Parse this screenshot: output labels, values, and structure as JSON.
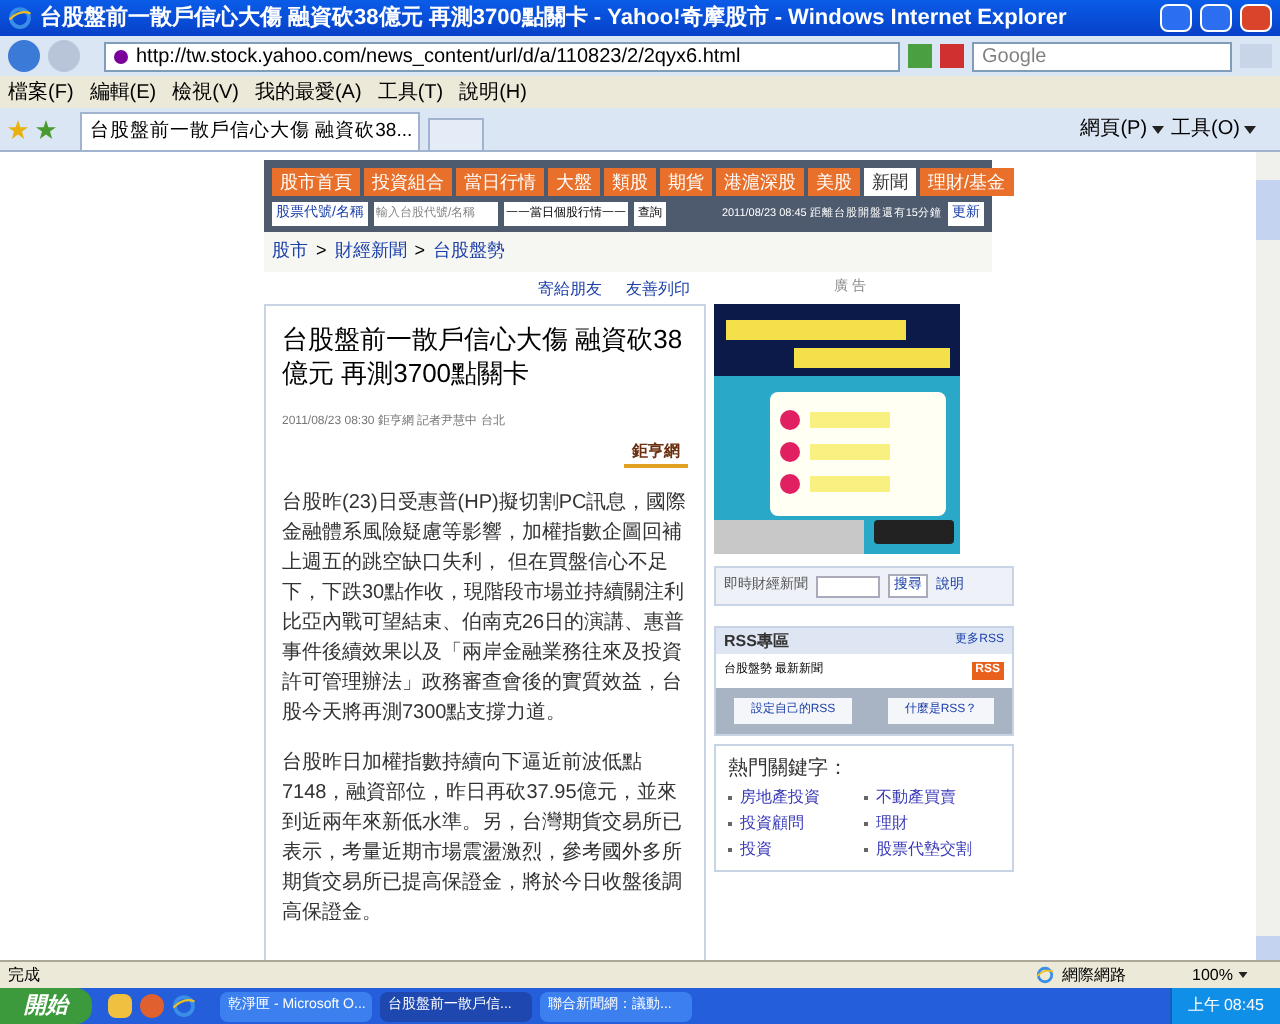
{
  "window": {
    "title": "台股盤前一散戶信心大傷 融資砍38億元 再測3700點關卡 - Yahoo!奇摩股市 - Windows Internet Explorer"
  },
  "address": {
    "url": "http://tw.stock.yahoo.com/news_content/url/d/a/110823/2/2qyx6.html"
  },
  "search": {
    "placeholder": "Google"
  },
  "menu": [
    "檔案(F)",
    "編輯(E)",
    "檢視(V)",
    "我的最愛(A)",
    "工具(T)",
    "說明(H)"
  ],
  "tab": {
    "title": "台股盤前一散戶信心大傷 融資砍38..."
  },
  "command_bar": [
    "網頁(P)",
    "工具(O)"
  ],
  "nav_tabs": [
    {
      "label": "股市首頁",
      "selected": false
    },
    {
      "label": "投資組合",
      "selected": false
    },
    {
      "label": "當日行情",
      "selected": false
    },
    {
      "label": "大盤",
      "selected": false
    },
    {
      "label": "類股",
      "selected": false
    },
    {
      "label": "期貨",
      "selected": false
    },
    {
      "label": "港滬深股",
      "selected": false
    },
    {
      "label": "美股",
      "selected": false
    },
    {
      "label": "新聞",
      "selected": true
    },
    {
      "label": "理財/基金",
      "selected": false
    }
  ],
  "quote_bar": {
    "label": "股票代號/名稱",
    "placeholder": "輸入台股代號/名稱",
    "select": "一一當日個股行情一一",
    "button": "查詢",
    "notice": "2011/08/23 08:45 距離台股開盤還有15分鐘",
    "refresh": "更新"
  },
  "breadcrumb": [
    "股市",
    "財經新聞",
    "台股盤勢"
  ],
  "breadcrumb_separator": ">",
  "tools": [
    "寄給朋友",
    "友善列印"
  ],
  "ad_label": "廣 告",
  "article": {
    "title": "台股盤前一散戶信心大傷 融資砍38億元 再測3700點關卡",
    "byline": "2011/08/23 08:30 鉅亨網 記者尹慧中 台北",
    "source": "鉅亨網",
    "paragraphs": [
      "台股昨(23)日受惠普(HP)擬切割PC訊息，國際金融體系風險疑慮等影響，加權指數企圖回補上週五的跳空缺口失利， 但在買盤信心不足下，下跌30點作收，現階段市場並持續關注利比亞內戰可望結束、伯南克26日的演講、惠普事件後續效果以及「兩岸金融業務往來及投資許可管理辦法」政務審查會後的實質效益，台股今天將再測7300點支撐力道。",
      "台股昨日加權指數持續向下逼近前波低點7148，融資部位，昨日再砍37.95億元，並來到近兩年來新低水準。另，台灣期貨交易所已表示，考量近期市場震盪激烈，參考國外多所期貨交易所已提高保證金，將於今日收盤後調高保證金。"
    ]
  },
  "news_search": {
    "label": "即時財經新聞",
    "button": "搜尋",
    "help": "說明"
  },
  "rss": {
    "title": "RSS專區",
    "more": "更多RSS",
    "feed": "台股盤勢 最新新聞",
    "badge": "RSS",
    "buttons": [
      "設定自己的RSS",
      "什麼是RSS？"
    ]
  },
  "keywords": {
    "title": "熱門關鍵字：",
    "items": [
      "房地產投資",
      "不動產買賣",
      "投資顧問",
      "理財",
      "投資",
      "股票代墊交割"
    ]
  },
  "status_bar": {
    "text": "完成",
    "zone": "網際網路",
    "zoom": "100%"
  },
  "taskbar": {
    "start": "開始",
    "items": [
      {
        "label": "乾淨匣 - Microsoft O...",
        "selected": false
      },
      {
        "label": "台股盤前一散戶信...",
        "selected": true
      },
      {
        "label": "聯合新聞網：議動...",
        "selected": false
      }
    ],
    "clock": "上午 08:45"
  }
}
